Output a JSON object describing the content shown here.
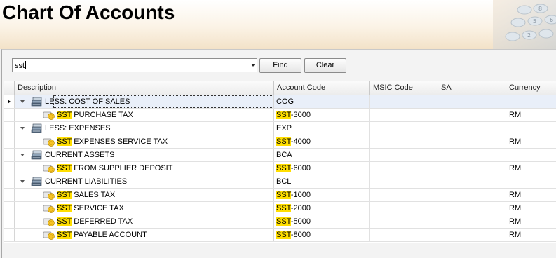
{
  "header": {
    "title": "Chart Of Accounts"
  },
  "search": {
    "value": "sst",
    "find_label": "Find",
    "clear_label": "Clear"
  },
  "grid": {
    "columns": [
      "Description",
      "Account Code",
      "MSIC Code",
      "SA",
      "Currency"
    ],
    "rows": [
      {
        "level": 0,
        "hl": "",
        "desc": "LESS: COST OF SALES",
        "code_hl": "",
        "code": "COG",
        "msic": "",
        "sa": "",
        "currency": "",
        "selected": true
      },
      {
        "level": 1,
        "hl": "SST",
        "desc": " PURCHASE TAX",
        "code_hl": "SST",
        "code": "-3000",
        "msic": "",
        "sa": "",
        "currency": "RM"
      },
      {
        "level": 0,
        "hl": "",
        "desc": "LESS: EXPENSES",
        "code_hl": "",
        "code": "EXP",
        "msic": "",
        "sa": "",
        "currency": ""
      },
      {
        "level": 1,
        "hl": "SST",
        "desc": " EXPENSES SERVICE TAX",
        "code_hl": "SST",
        "code": "-4000",
        "msic": "",
        "sa": "",
        "currency": "RM"
      },
      {
        "level": 0,
        "hl": "",
        "desc": "CURRENT ASSETS",
        "code_hl": "",
        "code": "BCA",
        "msic": "",
        "sa": "",
        "currency": ""
      },
      {
        "level": 1,
        "hl": "SST",
        "desc": " FROM SUPPLIER DEPOSIT",
        "code_hl": "SST",
        "code": "-6000",
        "msic": "",
        "sa": "",
        "currency": "RM"
      },
      {
        "level": 0,
        "hl": "",
        "desc": "CURRENT LIABILITIES",
        "code_hl": "",
        "code": "BCL",
        "msic": "",
        "sa": "",
        "currency": ""
      },
      {
        "level": 1,
        "hl": "SST",
        "desc": " SALES TAX",
        "code_hl": "SST",
        "code": "-1000",
        "msic": "",
        "sa": "",
        "currency": "RM"
      },
      {
        "level": 1,
        "hl": "SST",
        "desc": " SERVICE TAX",
        "code_hl": "SST",
        "code": "-2000",
        "msic": "",
        "sa": "",
        "currency": "RM"
      },
      {
        "level": 1,
        "hl": "SST",
        "desc": " DEFERRED TAX",
        "code_hl": "SST",
        "code": "-5000",
        "msic": "",
        "sa": "",
        "currency": "RM"
      },
      {
        "level": 1,
        "hl": "SST",
        "desc": " PAYABLE ACCOUNT",
        "code_hl": "SST",
        "code": "-8000",
        "msic": "",
        "sa": "",
        "currency": "RM"
      }
    ]
  },
  "colors": {
    "highlight": "#ffde00",
    "selected_row": "#e9eff9"
  },
  "icons": {
    "group": "stacked-books-icon",
    "account": "coins-icon",
    "row_indicator": "row-indicator-arrow-icon",
    "expander": "collapse-triangle-icon"
  }
}
